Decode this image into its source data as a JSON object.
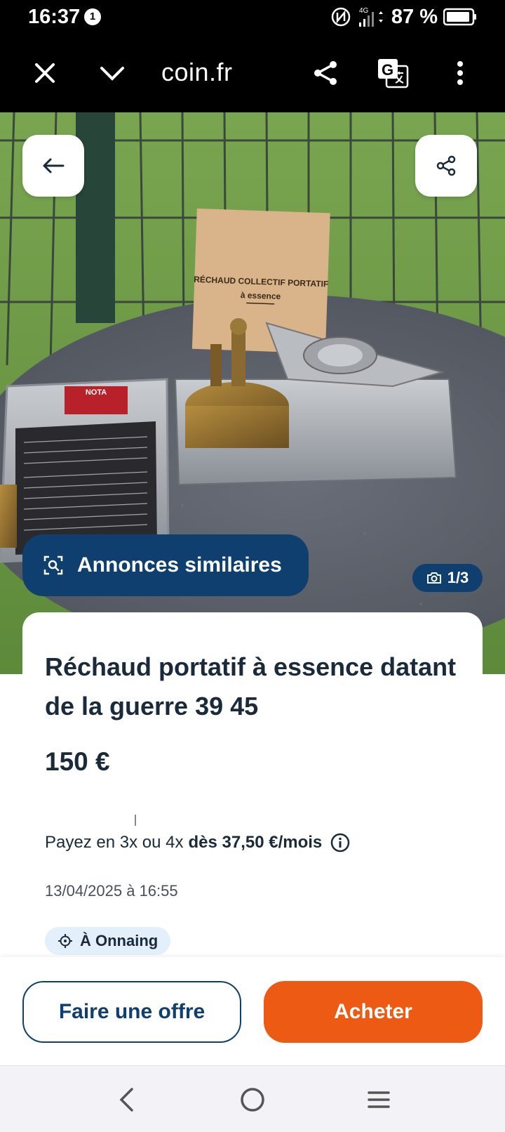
{
  "status_bar": {
    "time": "16:37",
    "notification_count": "1",
    "battery": "87 %",
    "network": "4G"
  },
  "browser": {
    "url": "coin.fr",
    "icons": [
      "close-icon",
      "chevron-down-icon",
      "share-icon",
      "translate-icon",
      "more-vert-icon"
    ]
  },
  "listing": {
    "similar_label": "Annonces similaires",
    "photo_counter": "1/3",
    "title": "Réchaud portatif à essence datant de la guerre 39 45",
    "price": "150 €",
    "installments_prefix": "Payez en 3x ou 4x",
    "installments_amount": "dès 37,50 €/mois",
    "date": "13/04/2025 à 16:55",
    "location": "À Onnaing"
  },
  "photo": {
    "booklet_line1": "RÉCHAUD COLLECTIF PORTATIF",
    "booklet_line2": "à essence",
    "lid_label": "NOTA"
  },
  "actions": {
    "offer_label": "Faire une offre",
    "buy_label": "Acheter"
  },
  "colors": {
    "primary": "#0e3f6e",
    "accent": "#ec5a13",
    "chip_bg": "#e3f0fb"
  }
}
